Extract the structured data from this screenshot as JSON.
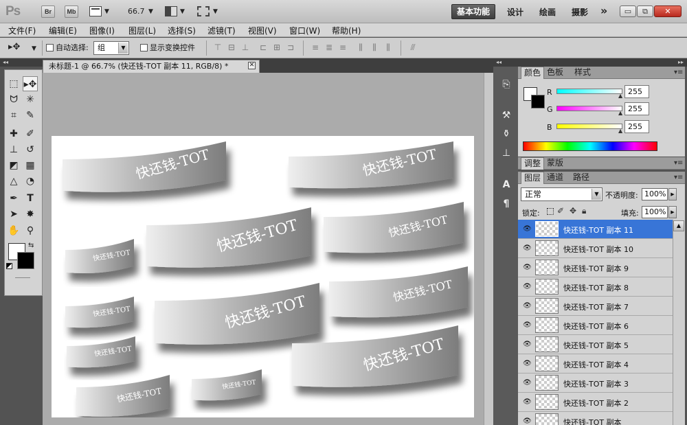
{
  "app": {
    "logo": "Ps",
    "bridge_label": "Br",
    "minibridge_label": "Mb",
    "zoom": "66.7",
    "workspaces": {
      "active": "基本功能",
      "items": [
        "设计",
        "绘画",
        "摄影"
      ],
      "more": "»"
    },
    "window_buttons": {
      "minimize": "▭",
      "restore": "⧉",
      "close": "✕"
    },
    "colors": {
      "accent": "#3875d7",
      "chrome": "#535353",
      "close": "#c9362b"
    }
  },
  "menubar": [
    "文件(F)",
    "编辑(E)",
    "图像(I)",
    "图层(L)",
    "选择(S)",
    "滤镜(T)",
    "视图(V)",
    "窗口(W)",
    "帮助(H)"
  ],
  "options": {
    "auto_select_label": "自动选择:",
    "auto_select_value": "组",
    "show_transform_label": "显示变换控件"
  },
  "document": {
    "tab_title": "未标题-1 @ 66.7% (快还钱-TOT 副本 11, RGB/8) *",
    "close": "✕",
    "ribbon_text": "快还钱-TOT"
  },
  "panels": {
    "top_tabs": [
      "颜色",
      "色板",
      "样式"
    ],
    "color": {
      "r_label": "R",
      "g_label": "G",
      "b_label": "B",
      "r": "255",
      "g": "255",
      "b": "255"
    },
    "mid_tabs": [
      "调整",
      "蒙版"
    ],
    "layer_tabs": [
      "图层",
      "通道",
      "路径"
    ],
    "layers": {
      "blend_mode": "正常",
      "opacity_label": "不透明度:",
      "opacity": "100%",
      "lock_label": "锁定:",
      "fill_label": "填充:",
      "fill": "100%",
      "items": [
        {
          "name": "快还钱-TOT 副本 11",
          "selected": true
        },
        {
          "name": "快还钱-TOT 副本 10"
        },
        {
          "name": "快还钱-TOT 副本 9"
        },
        {
          "name": "快还钱-TOT 副本 8"
        },
        {
          "name": "快还钱-TOT 副本 7"
        },
        {
          "name": "快还钱-TOT 副本 6"
        },
        {
          "name": "快还钱-TOT 副本 5"
        },
        {
          "name": "快还钱-TOT 副本 4"
        },
        {
          "name": "快还钱-TOT 副本 3"
        },
        {
          "name": "快还钱-TOT 副本 2"
        },
        {
          "name": "快还钱-TOT 副本"
        }
      ]
    }
  }
}
